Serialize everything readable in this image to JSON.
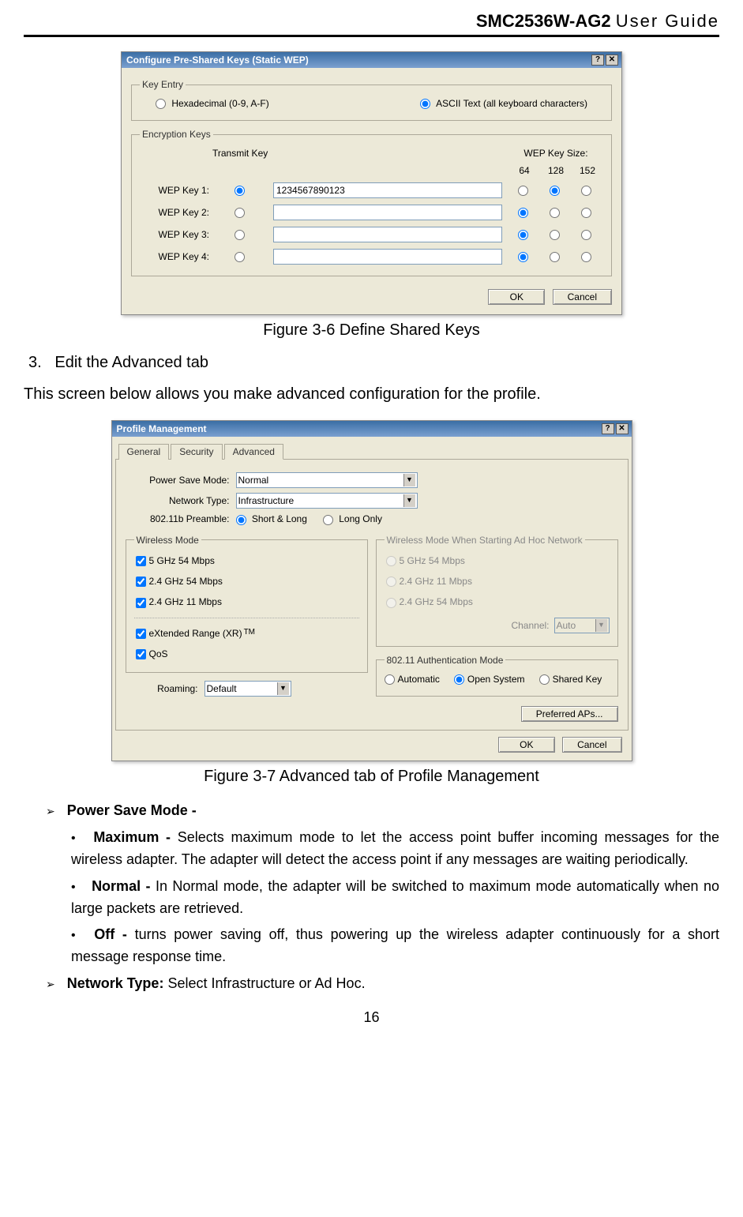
{
  "header": {
    "model": "SMC2536W-AG2",
    "guide": "User Guide"
  },
  "fig1": {
    "caption": "Figure 3-6 Define Shared Keys",
    "title": "Configure Pre-Shared Keys (Static WEP)",
    "help": "?",
    "close": "✕",
    "grp_keyentry": "Key Entry",
    "hex": "Hexadecimal (0-9, A-F)",
    "ascii": "ASCII Text (all keyboard characters)",
    "grp_enc": "Encryption Keys",
    "transmit": "Transmit Key",
    "wepsize": "WEP Key Size:",
    "sizes": [
      "64",
      "128",
      "152"
    ],
    "keys": [
      {
        "label": "WEP Key 1:",
        "value": "1234567890123",
        "tx": true,
        "size": 1
      },
      {
        "label": "WEP Key 2:",
        "value": "",
        "tx": false,
        "size": 0
      },
      {
        "label": "WEP Key 3:",
        "value": "",
        "tx": false,
        "size": 0
      },
      {
        "label": "WEP Key 4:",
        "value": "",
        "tx": false,
        "size": 0
      }
    ],
    "ok": "OK",
    "cancel": "Cancel"
  },
  "step3": {
    "num": "3.",
    "text": "Edit the Advanced tab"
  },
  "para1": "This screen below allows you make advanced configuration for the profile.",
  "fig2": {
    "caption": "Figure 3-7 Advanced tab of Profile Management",
    "title": "Profile Management",
    "help": "?",
    "close": "✕",
    "tabs": [
      "General",
      "Security",
      "Advanced"
    ],
    "psm_lbl": "Power Save Mode:",
    "psm_val": "Normal",
    "nt_lbl": "Network Type:",
    "nt_val": "Infrastructure",
    "pre_lbl": "802.11b Preamble:",
    "pre_opt1": "Short & Long",
    "pre_opt2": "Long Only",
    "grp_wm": "Wireless Mode",
    "wm": [
      {
        "label": "5 GHz 54 Mbps",
        "checked": true
      },
      {
        "label": "2.4 GHz 54 Mbps",
        "checked": true
      },
      {
        "label": "2.4 GHz 11 Mbps",
        "checked": true
      }
    ],
    "xr": "eXtended Range (XR)",
    "tm": "TM",
    "qos": "QoS",
    "roam_lbl": "Roaming:",
    "roam_val": "Default",
    "grp_adhoc": "Wireless Mode When Starting Ad Hoc Network",
    "adhoc": [
      "5 GHz 54 Mbps",
      "2.4 GHz 11 Mbps",
      "2.4 GHz 54 Mbps"
    ],
    "chan_lbl": "Channel:",
    "chan_val": "Auto",
    "grp_auth": "802.11 Authentication Mode",
    "auth": [
      "Automatic",
      "Open System",
      "Shared Key"
    ],
    "prefap": "Preferred APs...",
    "ok": "OK",
    "cancel": "Cancel"
  },
  "bullets": {
    "psm_head": "Power Save Mode -",
    "max_b": "Maximum -",
    "max_t": "Selects maximum mode to let the access point buffer incoming messages for the wireless adapter.  The adapter will detect the access point if any messages are waiting periodically.",
    "nor_b": "Normal -",
    "nor_t": "In Normal mode, the adapter will be switched to maximum mode automatically when no large packets are retrieved.",
    "off_b": "Off -",
    "off_t": "turns power saving off, thus powering up the wireless adapter continuously for a short message response time.",
    "nt_b": "Network Type:",
    "nt_t": "Select Infrastructure or Ad Hoc."
  },
  "page_no": "16"
}
